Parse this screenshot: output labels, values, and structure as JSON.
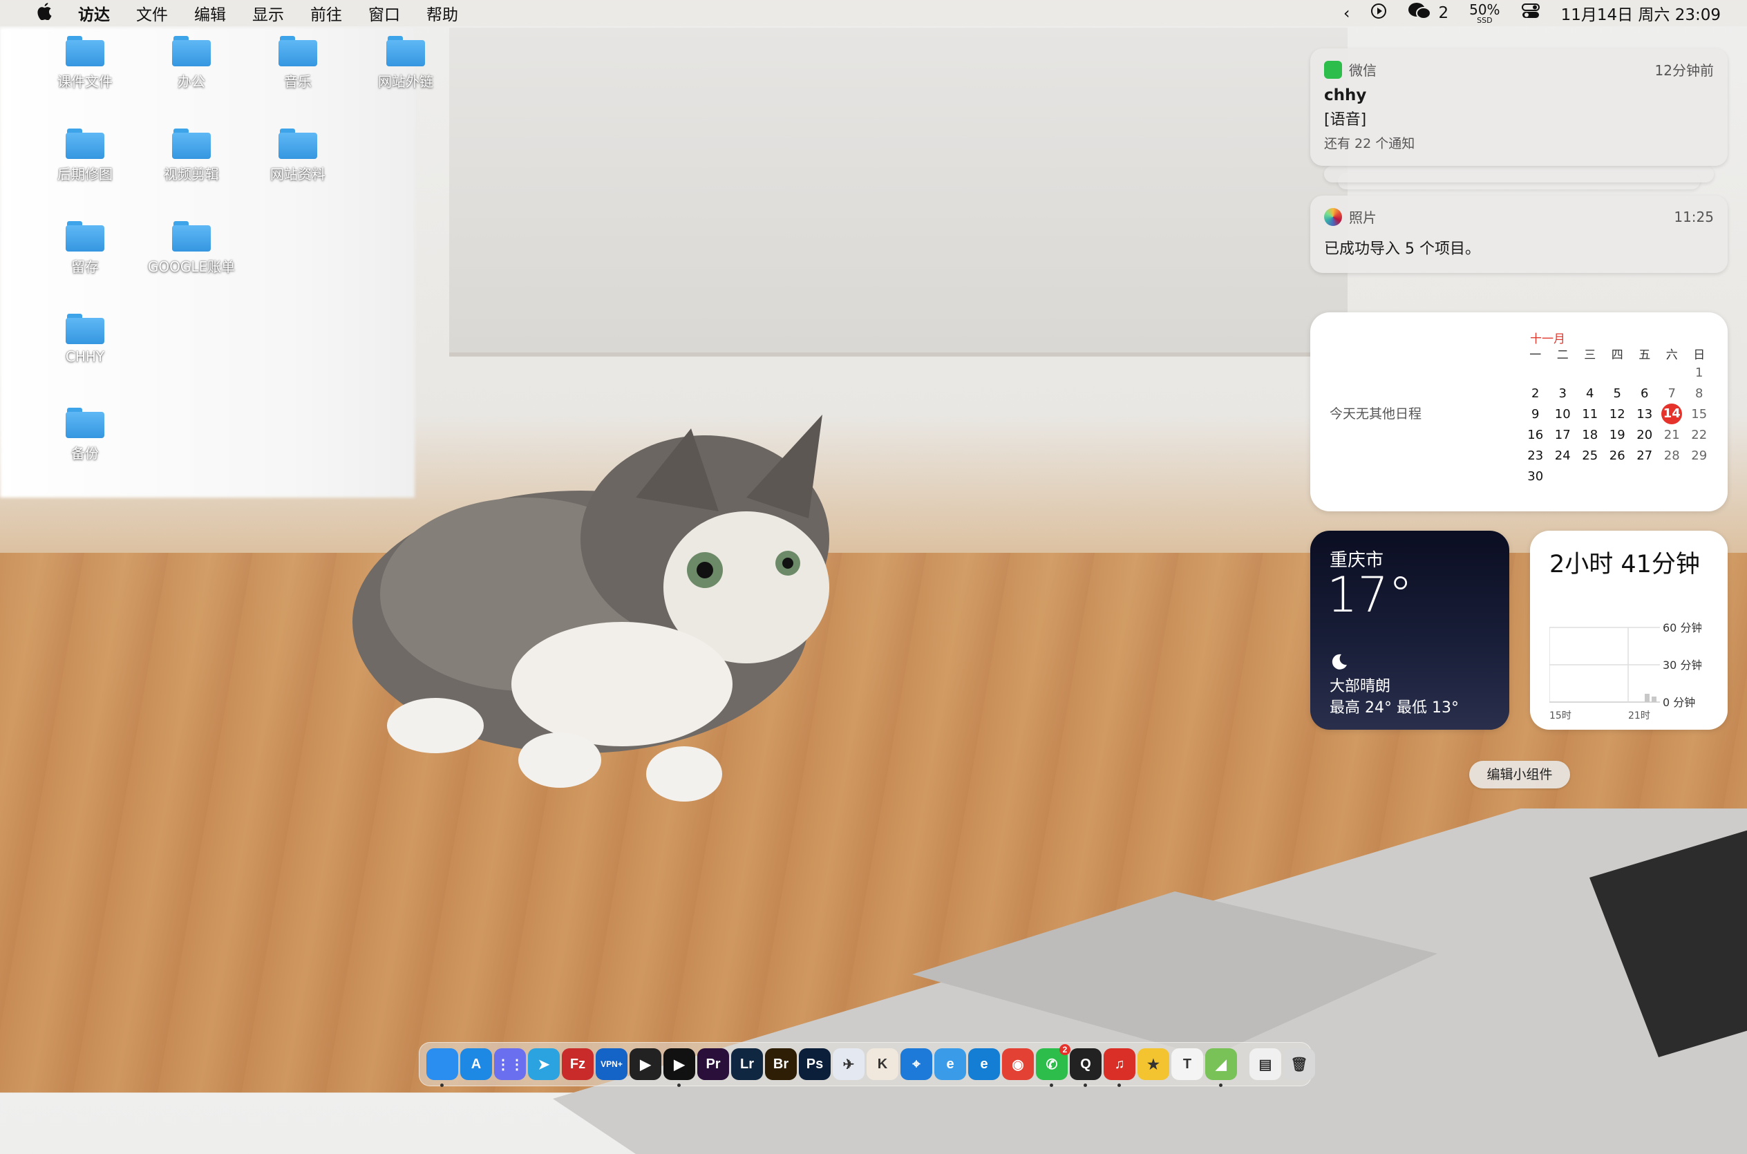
{
  "menubar": {
    "apple": "",
    "items": [
      "访达",
      "文件",
      "编辑",
      "显示",
      "前往",
      "窗口",
      "帮助"
    ],
    "wechat_count": "2",
    "battery_percent": "50%",
    "battery_label": "SSD",
    "datetime": "11月14日 周六 23:09"
  },
  "desktop": {
    "folders": [
      "课件文件",
      "办公",
      "音乐",
      "网站外链",
      "后期修图",
      "视频剪辑",
      "网站资料",
      "留存",
      "GOOGLE账单",
      "CHHY",
      "备份"
    ]
  },
  "notifications": [
    {
      "app": "微信",
      "time": "12分钟前",
      "title": "chhy",
      "body": "[语音]",
      "more": "还有 22 个通知"
    },
    {
      "app": "照片",
      "time": "11:25",
      "body": "已成功导入 5 个项目。"
    }
  ],
  "calendar": {
    "no_events": "今天无其他日程",
    "month": "十一月",
    "weekdays": [
      "一",
      "二",
      "三",
      "四",
      "五",
      "六",
      "日"
    ],
    "rows": [
      [
        "",
        "",
        "",
        "",
        "",
        "",
        "1"
      ],
      [
        "2",
        "3",
        "4",
        "5",
        "6",
        "7",
        "8"
      ],
      [
        "9",
        "10",
        "11",
        "12",
        "13",
        "14",
        "15"
      ],
      [
        "16",
        "17",
        "18",
        "19",
        "20",
        "21",
        "22"
      ],
      [
        "23",
        "24",
        "25",
        "26",
        "27",
        "28",
        "29"
      ],
      [
        "30",
        "",
        "",
        "",
        "",
        "",
        ""
      ]
    ],
    "today": "14"
  },
  "weather": {
    "city": "重庆市",
    "temp": "17°",
    "condition": "大部晴朗",
    "high_low": "最高 24° 最低 13°"
  },
  "screentime": {
    "total": "2小时 41分钟",
    "y_labels": [
      "60 分钟",
      "30 分钟",
      "0 分钟"
    ],
    "x_labels": [
      "15时",
      "21时"
    ]
  },
  "edit_widgets_label": "编辑小组件",
  "dock": {
    "apps": [
      {
        "name": "finder",
        "label": "",
        "color": "#2a8ef0"
      },
      {
        "name": "app-store",
        "label": "A",
        "color": "#1e88e5"
      },
      {
        "name": "launchpad",
        "label": "⋮⋮",
        "color": "#6a6ff0"
      },
      {
        "name": "telegram",
        "label": "➤",
        "color": "#2aa3e0"
      },
      {
        "name": "filezilla",
        "label": "Fz",
        "color": "#c92a2a"
      },
      {
        "name": "vpn",
        "label": "VPN+",
        "color": "#1463c7"
      },
      {
        "name": "quicktime",
        "label": "▶",
        "color": "#222"
      },
      {
        "name": "infuse",
        "label": "▶",
        "color": "#111"
      },
      {
        "name": "premiere",
        "label": "Pr",
        "color": "#2a0f3a"
      },
      {
        "name": "lightroom",
        "label": "Lr",
        "color": "#0f2740"
      },
      {
        "name": "bridge",
        "label": "Br",
        "color": "#2e1e05"
      },
      {
        "name": "photoshop",
        "label": "Ps",
        "color": "#0b1f3a"
      },
      {
        "name": "feishu",
        "label": "✈",
        "color": "#e4e8f0"
      },
      {
        "name": "kuaiqi",
        "label": "K",
        "color": "#f0e8dc"
      },
      {
        "name": "safari",
        "label": "⌖",
        "color": "#1e7ad8"
      },
      {
        "name": "edge-beta",
        "label": "e",
        "color": "#3a9be8"
      },
      {
        "name": "edge",
        "label": "e",
        "color": "#137ed4"
      },
      {
        "name": "chrome",
        "label": "◉",
        "color": "#e34133"
      },
      {
        "name": "wechat",
        "label": "✆",
        "color": "#2dbd4a",
        "badge": "2"
      },
      {
        "name": "qq",
        "label": "Q",
        "color": "#222"
      },
      {
        "name": "netease-music",
        "label": "♫",
        "color": "#d92f26"
      },
      {
        "name": "notes-star",
        "label": "★",
        "color": "#f4c430"
      },
      {
        "name": "typora",
        "label": "T",
        "color": "#f4f4f4"
      },
      {
        "name": "android",
        "label": "◢",
        "color": "#78c257"
      }
    ],
    "extras": [
      {
        "name": "file-doc",
        "label": "▤",
        "color": "#f0f0f0"
      },
      {
        "name": "trash",
        "label": "🗑",
        "color": "#d8d8d8"
      }
    ]
  }
}
